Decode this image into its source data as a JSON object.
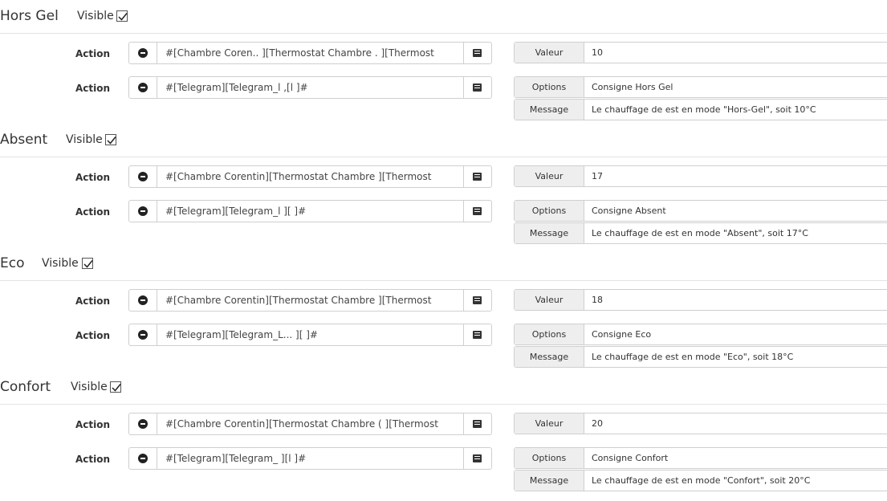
{
  "visible_label": "Visible",
  "action_label": "Action",
  "list_icon_name": "list-icon",
  "remove_icon_name": "minus-circle-icon",
  "sections": [
    {
      "title": "Hors Gel",
      "visible": true,
      "action1": "#[Chambre Coren.. ][Thermostat Chambre .          ][Thermost",
      "action2": "#[Telegram][Telegram_l          ,[l                         ]#",
      "valeur_label": "Valeur",
      "valeur": "10",
      "options_label": "Options",
      "options": "Consigne Hors Gel",
      "message_label": "Message",
      "message": "Le chauffage de                est en mode \"Hors-Gel\", soit 10°C"
    },
    {
      "title": "Absent",
      "visible": true,
      "action1": "#[Chambre Corentin][Thermostat Chambre            ][Thermost",
      "action2": "#[Telegram][Telegram_l            ][                        ]#",
      "valeur_label": "Valeur",
      "valeur": "17",
      "options_label": "Options",
      "options": "Consigne Absent",
      "message_label": "Message",
      "message": "Le chauffage de               est en mode \"Absent\", soit 17°C"
    },
    {
      "title": "Eco",
      "visible": true,
      "action1": "#[Chambre Corentin][Thermostat Chambre            ][Thermost",
      "action2": "#[Telegram][Telegram_L...    ][                          ]#",
      "valeur_label": "Valeur",
      "valeur": "18",
      "options_label": "Options",
      "options": "Consigne Eco",
      "message_label": "Message",
      "message": "Le chauffage de               est en mode \"Eco\", soit 18°C"
    },
    {
      "title": "Confort",
      "visible": true,
      "action1": "#[Chambre Corentin][Thermostat Chambre (         ][Thermost",
      "action2": "#[Telegram][Telegram_           ][l                         ]#",
      "valeur_label": "Valeur",
      "valeur": "20",
      "options_label": "Options",
      "options": "Consigne Confort",
      "message_label": "Message",
      "message": "Le chauffage de               est en mode \"Confort\", soit 20°C"
    }
  ]
}
